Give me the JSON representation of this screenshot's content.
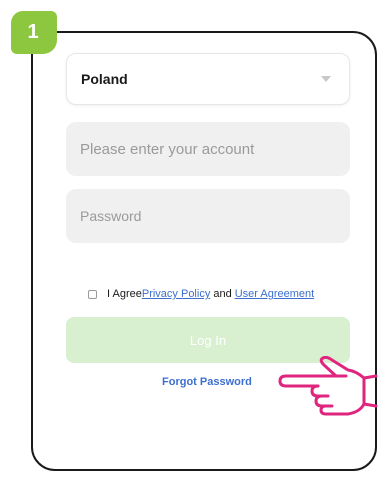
{
  "step_badge": "1",
  "country": {
    "selected": "Poland",
    "icon": "chevron-down-icon"
  },
  "account_input": {
    "placeholder": "Please enter your account",
    "value": ""
  },
  "password_input": {
    "placeholder": "Password",
    "value": ""
  },
  "agreement": {
    "checked": false,
    "prefix": "I Agree",
    "privacy_link": "Privacy Policy",
    "and_text": "and",
    "user_agreement_link": "User Agreement"
  },
  "login_button": {
    "label": "Log In"
  },
  "forgot_password": {
    "label": "Forgot Password"
  },
  "colors": {
    "badge": "#8dc63f",
    "link": "#3d6fcf",
    "login_button_bg": "#d8f0cf",
    "pointer_hand": "#e0257f",
    "field_bg": "#f0f0f0"
  },
  "icons": {
    "pointer": "pointing-hand-icon"
  }
}
